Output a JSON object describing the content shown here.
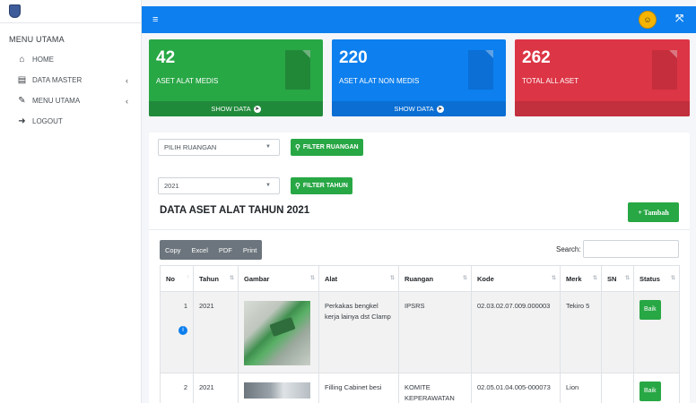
{
  "sidebar": {
    "menu_heading": "MENU UTAMA",
    "items": [
      {
        "label": "HOME",
        "icon": "home-icon",
        "has_arrow": false
      },
      {
        "label": "DATA MASTER",
        "icon": "database-icon",
        "has_arrow": true
      },
      {
        "label": "MENU UTAMA",
        "icon": "edit-icon",
        "has_arrow": true
      },
      {
        "label": "LOGOUT",
        "icon": "logout-icon",
        "has_arrow": false
      }
    ],
    "arrow_glyph": "‹"
  },
  "topbar": {
    "menu_glyph": "≡",
    "expand_glyph": "⤧",
    "color": "#0d7fee"
  },
  "stats": [
    {
      "value": "42",
      "label": "ASET ALAT MEDIS",
      "footer": "SHOW DATA",
      "color": "#28a745"
    },
    {
      "value": "220",
      "label": "ASET ALAT NON MEDIS",
      "footer": "SHOW DATA",
      "color": "#0d7fee"
    },
    {
      "value": "262",
      "label": "TOTAL ALL ASET",
      "footer": "",
      "color": "#dc3545"
    }
  ],
  "filters": {
    "room_select": "PILIH RUANGAN",
    "room_button": "FILTER RUANGAN",
    "year_select": "2021",
    "year_button": "FILTER TAHUN"
  },
  "section": {
    "title": "DATA ASET ALAT TAHUN 2021",
    "add_button": "+ Tambah"
  },
  "toolbar": {
    "buttons": [
      "Copy",
      "Excel",
      "PDF",
      "Print"
    ],
    "search_label": "Search:",
    "search_value": ""
  },
  "table": {
    "columns": [
      "No",
      "Tahun",
      "Gambar",
      "Alat",
      "Ruangan",
      "Kode",
      "Merk",
      "SN",
      "Status"
    ],
    "rows": [
      {
        "no": "1",
        "tahun": "2021",
        "alat": "Perkakas bengkel kerja lainya dst Clamp",
        "ruangan": "IPSRS",
        "kode": "02.03.02.07.009.000003",
        "merk": "Tekiro 5",
        "sn": "",
        "status": "Baik"
      },
      {
        "no": "2",
        "tahun": "2021",
        "alat": "Filling Cabinet besi",
        "ruangan": "KOMITE KEPERAWATAN",
        "kode": "02.05.01.04.005-000073",
        "merk": "Lion",
        "sn": "",
        "status": "Baik"
      }
    ]
  }
}
